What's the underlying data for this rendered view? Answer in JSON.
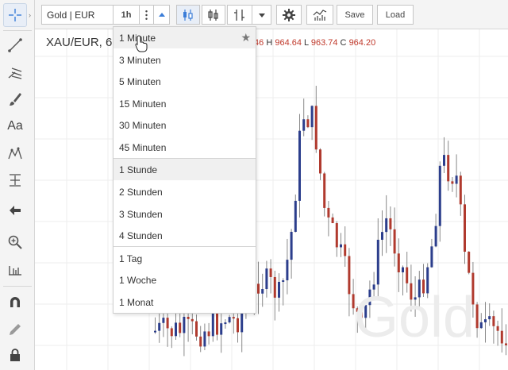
{
  "toolbar": {
    "symbol": "Gold | EUR",
    "interval_label": "1h",
    "save_label": "Save",
    "load_label": "Load"
  },
  "chart": {
    "symbol_title": "XAU/EUR, 6",
    "ohlc": {
      "o_value": "46",
      "h_label": "H",
      "h_value": "964.64",
      "l_label": "L",
      "l_value": "963.74",
      "c_label": "C",
      "c_value": "964.20"
    },
    "watermark": "Gold"
  },
  "interval_menu": {
    "items": [
      {
        "label": "1 Minute"
      },
      {
        "label": "3 Minuten"
      },
      {
        "label": "5 Minuten"
      },
      {
        "label": "15 Minuten"
      },
      {
        "label": "30 Minuten"
      },
      {
        "label": "45 Minuten"
      },
      {
        "label": "1 Stunde"
      },
      {
        "label": "2 Stunden"
      },
      {
        "label": "3 Stunden"
      },
      {
        "label": "4 Stunden"
      },
      {
        "label": "1 Tag"
      },
      {
        "label": "1 Woche"
      },
      {
        "label": "1 Monat"
      }
    ],
    "favorite_item": "1 Minute",
    "hovered_item": "1 Minute",
    "selected_item": "1 Stunde"
  },
  "colors": {
    "up_candle": "#2c3e8c",
    "down_candle": "#b03a2e",
    "accent": "#3b7dd8",
    "ohlc_value": "#c0392b"
  },
  "icons": {
    "left": [
      "crosshair-icon",
      "trend-line-icon",
      "pitchfork-icon",
      "brush-icon",
      "text-icon",
      "pattern-icon",
      "measure-icon",
      "arrow-left-icon",
      "zoom-icon",
      "ruler-icon",
      "magnet-icon",
      "pencil-icon",
      "lock-icon"
    ],
    "top": [
      "more-vertical-icon",
      "chevron-up-icon",
      "candles-icon",
      "bars-icon",
      "compare-icon",
      "chevron-down-icon",
      "gear-icon",
      "indicator-icon"
    ]
  }
}
